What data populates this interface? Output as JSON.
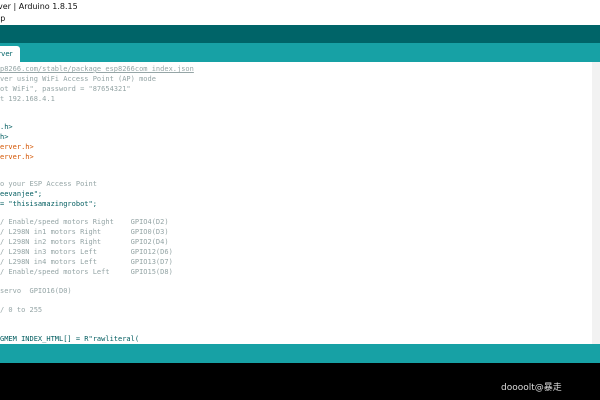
{
  "window": {
    "title": "ver | Arduino 1.8.15"
  },
  "menu": {
    "partial_label": "lp"
  },
  "tab": {
    "label": "erver"
  },
  "editor": {
    "lines": [
      "p8266.com/stable/package_esp8266com_index.json",
      "ver using WiFi Access Point (AP) mode",
      "ot WiFi\", password = \"87654321\"",
      "t 192.168.4.1",
      ".h>",
      "h>",
      "erver.h>",
      "erver.h>",
      "o your ESP Access Point",
      "eevanjee\";",
      "= \"thisisamazingrobot\";",
      "/ Enable/speed motors Right    GPIO4(D2)",
      "/ L298N in1 motors Right       GPIO0(D3)",
      "/ L298N in2 motors Right       GPIO2(D4)",
      "/ L298N in3 motors Left        GPIO12(D6)",
      "/ L298N in4 motors Left        GPIO13(D7)",
      "/ Enable/speed motors Left     GPIO15(D8)",
      "servo  GPIO16(D0)",
      "/ 0 to 255",
      "GMEM INDEX_HTML[] = R\"rawliteral("
    ]
  },
  "watermark": {
    "text": "doooolt@暴走"
  }
}
